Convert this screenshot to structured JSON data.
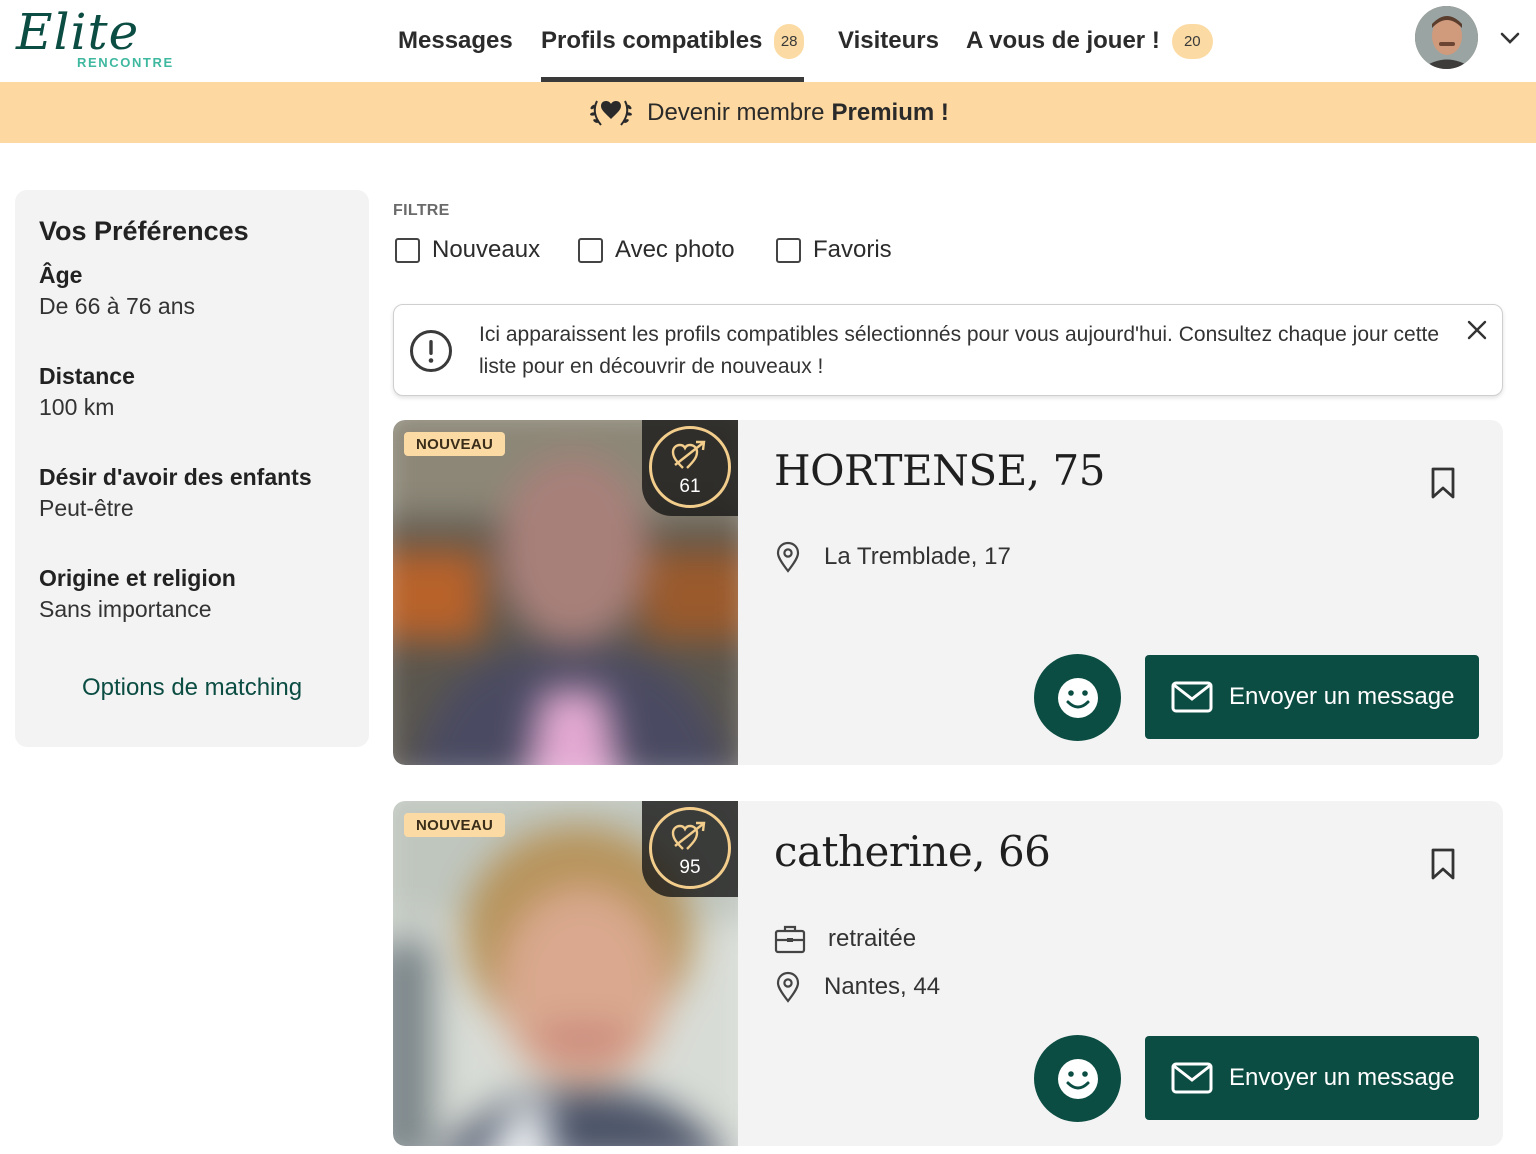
{
  "brand": {
    "name": "Elite",
    "subtitle": "RENCONTRE"
  },
  "nav": {
    "messages": "Messages",
    "compatible": "Profils compatibles",
    "compatible_count": "28",
    "visitors": "Visiteurs",
    "your_turn": "A vous de jouer !",
    "your_turn_count": "20"
  },
  "premium": {
    "prefix": "Devenir membre",
    "strong": "Premium !"
  },
  "preferences": {
    "title": "Vos Préférences",
    "age_label": "Âge",
    "age_value": "De 66 à 76 ans",
    "distance_label": "Distance",
    "distance_value": "100 km",
    "children_label": "Désir d'avoir des enfants",
    "children_value": "Peut-être",
    "origin_label": "Origine et religion",
    "origin_value": "Sans importance",
    "matching_link": "Options de matching"
  },
  "filters": {
    "title": "FILTRE",
    "new": "Nouveaux",
    "with_photo": "Avec photo",
    "favorites": "Favoris"
  },
  "info": {
    "text": "Ici apparaissent les profils compatibles sélectionnés pour vous aujourd'hui. Consultez chaque jour cette liste pour en découvrir de nouveaux !"
  },
  "profiles": [
    {
      "badge": "NOUVEAU",
      "score": "61",
      "name": "HORTENSE, 75",
      "location": "La Tremblade, 17",
      "message_label": "Envoyer un message"
    },
    {
      "badge": "NOUVEAU",
      "score": "95",
      "name": "catherine, 66",
      "job": "retraitée",
      "location": "Nantes, 44",
      "message_label": "Envoyer un message"
    }
  ],
  "colors": {
    "brand_green": "#0c4d43",
    "accent_teal": "#3fb8a0",
    "premium_bg": "#fdd9a1",
    "badge_bg": "#fbdba3"
  }
}
